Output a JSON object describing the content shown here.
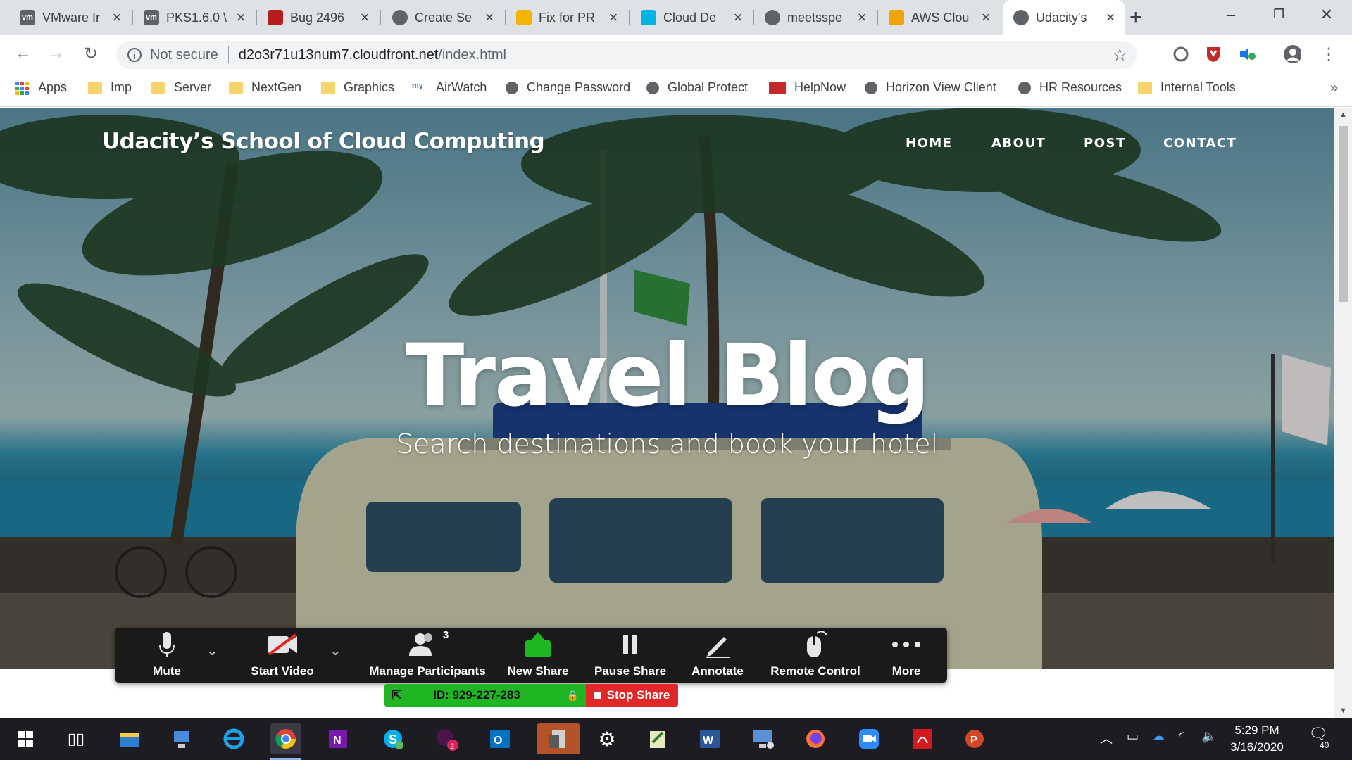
{
  "browser": {
    "tabs": [
      {
        "title": "VMware Ir",
        "favicon": "vm",
        "color": "#5f6368"
      },
      {
        "title": "PKS1.6.0 \\",
        "favicon": "vm",
        "color": "#5f6368"
      },
      {
        "title": "Bug 2496",
        "favicon": "bug-icon",
        "color": "#b71c1c"
      },
      {
        "title": "Create Se",
        "favicon": "globe-icon",
        "color": "#5f6368"
      },
      {
        "title": "Fix for PR",
        "favicon": "doc-icon",
        "color": "#f4b400"
      },
      {
        "title": "Cloud De",
        "favicon": "udacity-icon",
        "color": "#02b3e4"
      },
      {
        "title": "meetsspe",
        "favicon": "globe-icon",
        "color": "#5f6368"
      },
      {
        "title": "AWS Clou",
        "favicon": "aws-icon",
        "color": "#f0a30a"
      },
      {
        "title": "Udacity's",
        "favicon": "globe-icon",
        "color": "#5f6368",
        "active": true
      }
    ],
    "security_label": "Not secure",
    "url_host": "d2o3r71u13num7.cloudfront.net",
    "url_path": "/index.html",
    "bookmarks": [
      {
        "label": "Apps",
        "icon": "apps-grid-icon"
      },
      {
        "label": "Imp",
        "icon": "folder-icon"
      },
      {
        "label": "Server",
        "icon": "folder-icon"
      },
      {
        "label": "NextGen",
        "icon": "folder-icon"
      },
      {
        "label": "Graphics",
        "icon": "folder-icon"
      },
      {
        "label": "AirWatch",
        "icon": "airwatch-icon"
      },
      {
        "label": "Change Password",
        "icon": "globe-icon"
      },
      {
        "label": "Global Protect",
        "icon": "globe-icon"
      },
      {
        "label": "HelpNow",
        "icon": "helpnow-icon"
      },
      {
        "label": "Horizon View Client",
        "icon": "globe-icon"
      },
      {
        "label": "HR Resources",
        "icon": "globe-icon"
      },
      {
        "label": "Internal Tools",
        "icon": "folder-icon"
      }
    ],
    "bookmarks_overflow": "»"
  },
  "site": {
    "brand": "Udacity’s School of Cloud Computing",
    "nav": [
      "HOME",
      "ABOUT",
      "POST",
      "CONTACT"
    ],
    "hero_title": "Travel Blog",
    "hero_subtitle": "Search destinations and book your hotel"
  },
  "zoom": {
    "buttons": [
      "Mute",
      "Start Video",
      "Manage Participants",
      "New Share",
      "Pause Share",
      "Annotate",
      "Remote Control",
      "More"
    ],
    "participant_count": "3",
    "meeting_id": "ID: 929-227-283",
    "stop_share": "Stop Share",
    "accent": "#1fb523",
    "stop_color": "#e02828"
  },
  "taskbar": {
    "time": "5:29 PM",
    "date": "3/16/2020",
    "notifications": "40",
    "slack_badge": "2"
  }
}
